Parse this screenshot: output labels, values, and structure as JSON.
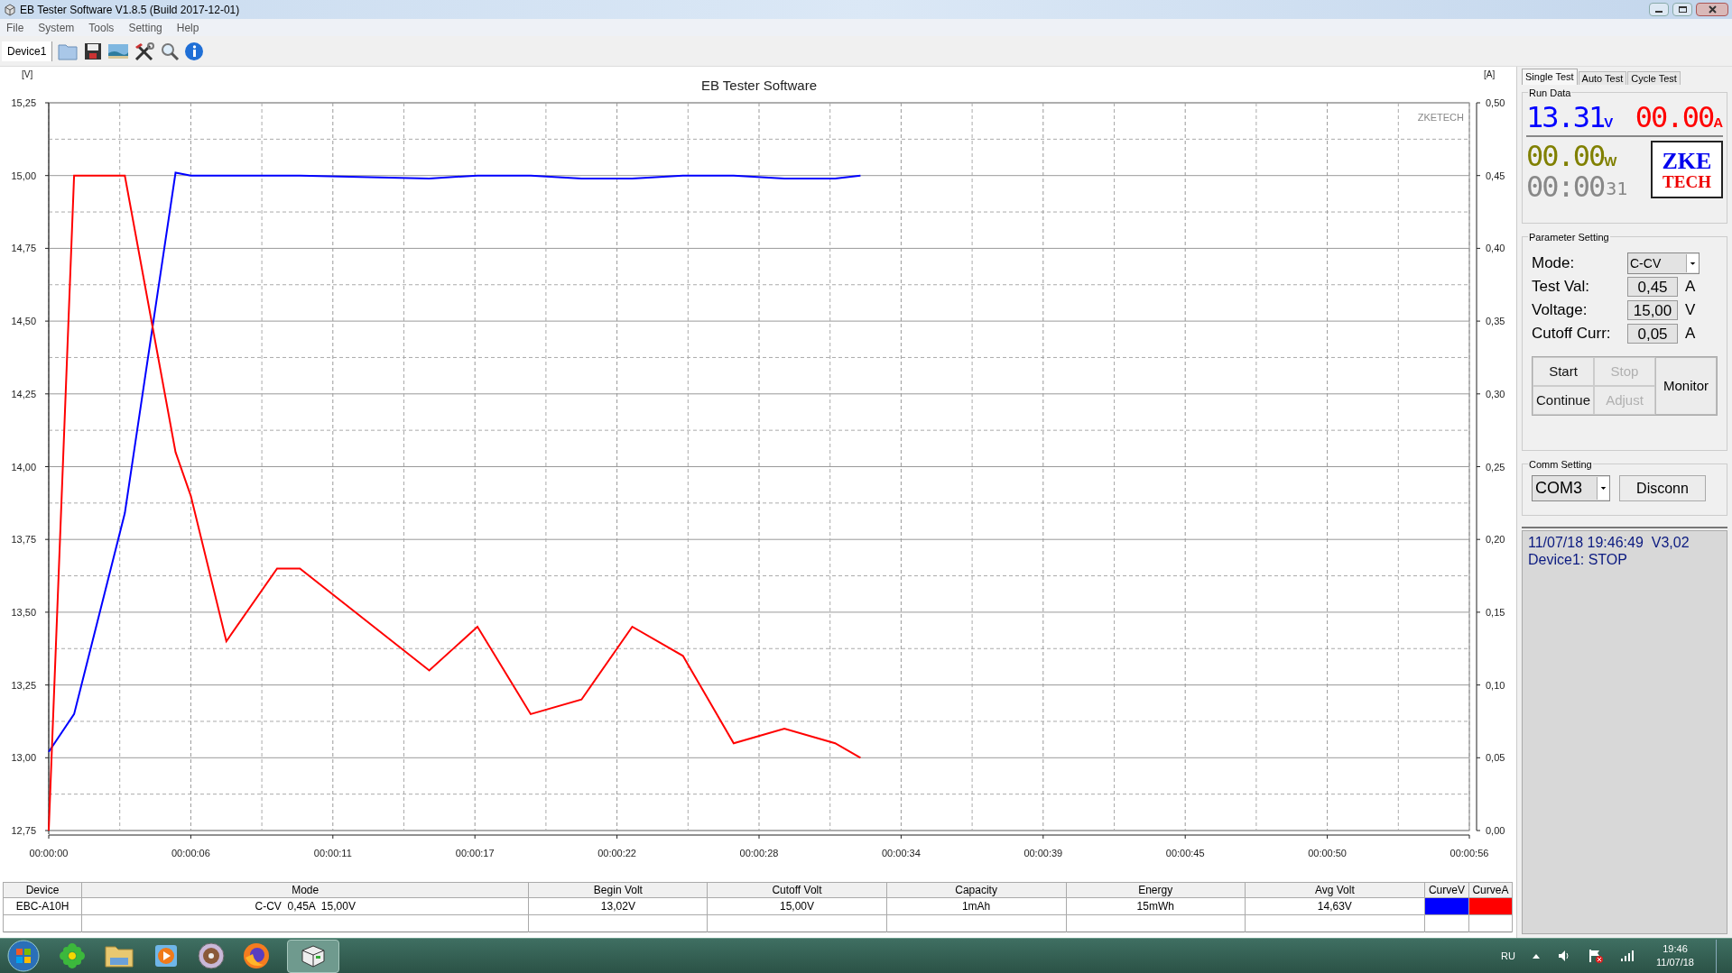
{
  "window": {
    "title": "EB Tester Software V1.8.5 (Build 2017-12-01)"
  },
  "menu": [
    "File",
    "System",
    "Tools",
    "Setting",
    "Help"
  ],
  "toolbar": {
    "device_tab": "Device1"
  },
  "chart": {
    "chart_data": {
      "type": "line",
      "title": "EB Tester Software",
      "ylabel": "[V]",
      "y2label": "[A]",
      "annotations": [
        "ZKETECH"
      ],
      "grid": true,
      "x": [
        0,
        1,
        3,
        5,
        5.6,
        7,
        9,
        9.9,
        15,
        16.9,
        19,
        21,
        23,
        25,
        27,
        29,
        31,
        32
      ],
      "xlim": [
        0,
        56
      ],
      "ylim": [
        12.75,
        15.25
      ],
      "y2lim": [
        0,
        0.5
      ],
      "xticks": [
        {
          "value": 0,
          "label": "00:00:00"
        },
        {
          "value": 5.6,
          "label": "00:00:06"
        },
        {
          "value": 11.2,
          "label": "00:00:11"
        },
        {
          "value": 16.8,
          "label": "00:00:17"
        },
        {
          "value": 22.4,
          "label": "00:00:22"
        },
        {
          "value": 28,
          "label": "00:00:28"
        },
        {
          "value": 33.6,
          "label": "00:00:34"
        },
        {
          "value": 39.2,
          "label": "00:00:39"
        },
        {
          "value": 44.8,
          "label": "00:00:45"
        },
        {
          "value": 50.4,
          "label": "00:00:50"
        },
        {
          "value": 56,
          "label": "00:00:56"
        }
      ],
      "yticks": [
        {
          "value": 12.75,
          "label": "12,75"
        },
        {
          "value": 13,
          "label": "13,00"
        },
        {
          "value": 13.25,
          "label": "13,25"
        },
        {
          "value": 13.5,
          "label": "13,50"
        },
        {
          "value": 13.75,
          "label": "13,75"
        },
        {
          "value": 14,
          "label": "14,00"
        },
        {
          "value": 14.25,
          "label": "14,25"
        },
        {
          "value": 14.5,
          "label": "14,50"
        },
        {
          "value": 14.75,
          "label": "14,75"
        },
        {
          "value": 15,
          "label": "15,00"
        },
        {
          "value": 15.25,
          "label": "15,25"
        }
      ],
      "y2ticks": [
        {
          "value": 0,
          "label": "0,00"
        },
        {
          "value": 0.05,
          "label": "0,05"
        },
        {
          "value": 0.1,
          "label": "0,10"
        },
        {
          "value": 0.15,
          "label": "0,15"
        },
        {
          "value": 0.2,
          "label": "0,20"
        },
        {
          "value": 0.25,
          "label": "0,25"
        },
        {
          "value": 0.3,
          "label": "0,30"
        },
        {
          "value": 0.35,
          "label": "0,35"
        },
        {
          "value": 0.4,
          "label": "0,40"
        },
        {
          "value": 0.45,
          "label": "0,45"
        },
        {
          "value": 0.5,
          "label": "0,50"
        }
      ],
      "series": [
        {
          "name": "CurveV",
          "axis": "y",
          "color": "#0000ff",
          "values": [
            13.02,
            13.15,
            13.84,
            15.01,
            15.0,
            15.0,
            15.0,
            15.0,
            14.99,
            15.0,
            15.0,
            14.99,
            14.99,
            15.0,
            15.0,
            14.99,
            14.99,
            15.0
          ]
        },
        {
          "name": "CurveA",
          "axis": "y2",
          "color": "#ff0000",
          "values": [
            0,
            0.45,
            0.45,
            0.26,
            0.23,
            0.13,
            0.18,
            0.18,
            0.11,
            0.14,
            0.08,
            0.09,
            0.14,
            0.12,
            0.06,
            0.07,
            0.06,
            0.05
          ]
        }
      ]
    }
  },
  "results_table": {
    "columns": [
      "Device",
      "Mode",
      "Begin Volt",
      "Cutoff Volt",
      "Capacity",
      "Energy",
      "Avg Volt"
    ],
    "rows": [
      [
        "EBC-A10H",
        "C-CV  0,45A  15,00V",
        "13,02V",
        "15,00V",
        "1mAh",
        "15mWh",
        "14,63V"
      ]
    ]
  },
  "side_panel": {
    "tabs": [
      {
        "label": "Single Test",
        "selected": true
      },
      {
        "label": "Auto Test",
        "selected": false
      },
      {
        "label": "Cycle Test",
        "selected": false
      }
    ],
    "run_data": {
      "title": "Run Data",
      "voltage": "13.31",
      "voltage_unit": "V",
      "current": "00.00",
      "current_unit": "A",
      "power": "00.00",
      "power_unit": "W",
      "time": "00:00",
      "seconds": "31",
      "logo": [
        "ZKE",
        "TECH"
      ]
    },
    "parameter_setting": {
      "title": "Parameter Setting",
      "mode_label": "Mode:",
      "mode": "C-CV",
      "fields": [
        {
          "label": "Test Val:",
          "value": "0,45",
          "unit": "A"
        },
        {
          "label": "Voltage:",
          "value": "15,00",
          "unit": "V"
        },
        {
          "label": "Cutoff Curr:",
          "value": "0,05",
          "unit": "A"
        }
      ],
      "buttons": [
        {
          "label": "Start",
          "disabled": false
        },
        {
          "label": "Stop",
          "disabled": true
        },
        {
          "label": "Continue",
          "disabled": false
        },
        {
          "label": "Adjust",
          "disabled": true
        }
      ],
      "monitor_button": "Monitor"
    },
    "comm_setting": {
      "title": "Comm Setting",
      "port": "COM3",
      "button": "Disconn"
    },
    "status": [
      "11/07/18 19:46:49  V3,02",
      "Device1: STOP"
    ]
  },
  "taskbar": {
    "language": "RU",
    "time": "19:46",
    "date": "11/07/18"
  }
}
